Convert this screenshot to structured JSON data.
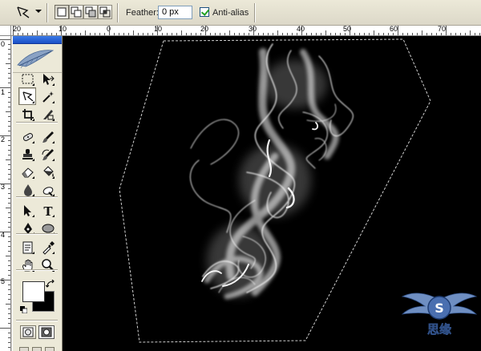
{
  "options_bar": {
    "tool_preset_icon": "polygonal-lasso-icon",
    "selection_modes": [
      "new-selection-icon",
      "add-to-selection-icon",
      "subtract-from-selection-icon",
      "intersect-selection-icon"
    ],
    "feather_label": "Feather:",
    "feather_value": "0 px",
    "anti_alias_label": "Anti-alias",
    "anti_alias_checked": true
  },
  "rulers": {
    "horizontal_labels": [
      "20",
      "10",
      "0",
      "10",
      "20",
      "30",
      "40",
      "50",
      "60",
      "70"
    ],
    "vertical_labels": [
      "0",
      "1",
      "2",
      "3",
      "4",
      "5"
    ]
  },
  "toolbox": {
    "tools": [
      "rectangular-marquee-icon",
      "move-icon",
      "polygonal-lasso-icon",
      "magic-wand-icon",
      "crop-icon",
      "slice-icon",
      "healing-brush-icon",
      "brush-icon",
      "clone-stamp-icon",
      "history-brush-icon",
      "eraser-icon",
      "paint-bucket-icon",
      "blur-icon",
      "dodge-icon",
      "path-selection-icon",
      "type-icon",
      "pen-icon",
      "ellipse-shape-icon",
      "notes-icon",
      "eyedropper-icon",
      "hand-icon",
      "zoom-icon"
    ],
    "active_tool": "polygonal-lasso-icon",
    "foreground_color": "#ffffff",
    "background_color": "#000000"
  },
  "colors": {
    "canvas": "#000000",
    "smoke": "#ffffff",
    "title_bar": "#1b50c6",
    "chrome": "#ece9d8"
  },
  "watermark": {
    "text": "思缘"
  }
}
